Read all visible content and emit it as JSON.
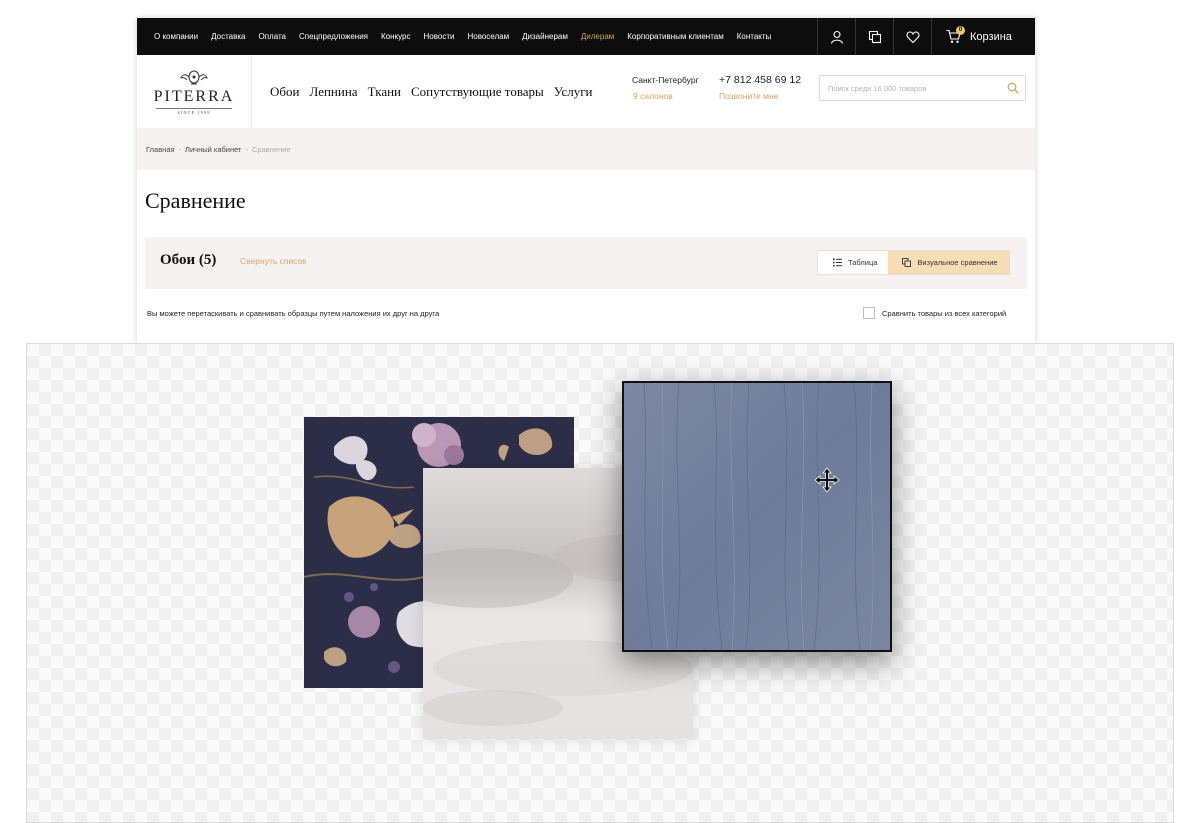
{
  "topbar": {
    "nav": [
      "О компании",
      "Доставка",
      "Оплата",
      "Спецпредложения",
      "Конкурс",
      "Новости",
      "Новоселам",
      "Дизайнерам",
      "Дилерам",
      "Корпоративным клиентам",
      "Контакты"
    ],
    "accent_item": "Дилерам",
    "icons": [
      "user-icon",
      "compare-icon",
      "heart-icon",
      "cart-icon"
    ],
    "cart_count": "0",
    "cart_label": "Корзина"
  },
  "header": {
    "logo_text": "PITERRA",
    "logo_since": "SINCE 1998",
    "nav": [
      "Обои",
      "Лепнина",
      "Ткани",
      "Сопутствующие товары",
      "Услуги"
    ],
    "city": "Санкт-Петербург",
    "salons": "9 салонов",
    "phone": "+7 812 458 69 12",
    "callback": "Позвоните мне",
    "search_placeholder": "Поиск среди 16 000 товаров"
  },
  "breadcrumb": {
    "items": [
      "Главная",
      "Личный кабинет"
    ],
    "current": "Сравнение",
    "separator": "-"
  },
  "page_title": "Сравнение",
  "category": {
    "title": "Обои (5)",
    "collapse_label": "Свернуть список",
    "view_table": "Таблица",
    "view_visual": "Визуальное сравнение",
    "active_view": "visual"
  },
  "hint": "Вы можете перетаскивать и сравнивать образцы путем наложения их друг на друга",
  "compare_all_label": "Сравнить товары из всех категорий",
  "colors": {
    "accent": "#d2a567",
    "topbar": "#0d0d0d",
    "active_toggle": "#f7ddb4",
    "crumb_bg": "#f7f2f2"
  }
}
